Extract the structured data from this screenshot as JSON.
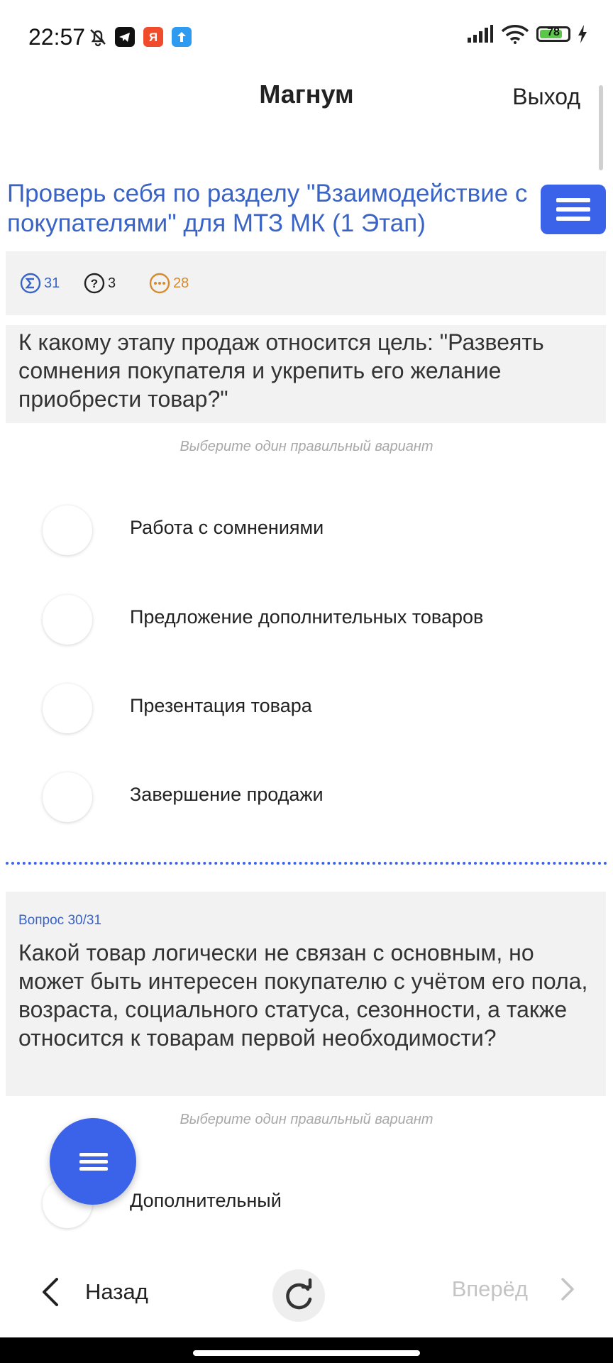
{
  "status_bar": {
    "time": "22:57",
    "battery": "78",
    "battery_level": 0.78,
    "icons": [
      "bell-off-icon",
      "telegram-icon",
      "yandex-icon",
      "upload-icon",
      "signal-icon",
      "wifi-icon",
      "charging-icon"
    ]
  },
  "header": {
    "title": "Магнум",
    "exit_label": "Выход"
  },
  "test": {
    "title": "Проверь себя по разделу \"Взаимодействие с покупателями\" для МТЗ МК (1 Этап)"
  },
  "stats": {
    "total": "31",
    "answered": "3",
    "remaining": "28",
    "colors": {
      "total": "#3a63c6",
      "answered": "#222222",
      "remaining": "#d68a2c"
    }
  },
  "questions": [
    {
      "text": "К какому этапу продаж относится цель: \"Развеять сомнения покупателя и укрепить его желание приобрести товар?\"",
      "hint": "Выберите один правильный вариант",
      "options": [
        "Работа с сомнениями",
        "Предложение дополнительных товаров",
        "Презентация товара",
        "Завершение продажи"
      ]
    },
    {
      "number": "Вопрос 30/31",
      "text": "Какой товар логически не связан с основным, но может быть интересен покупателю с учётом его пола, возраста, социального статуса, сезонности, а также относится к товарам первой необходимости?",
      "hint": "Выберите один правильный вариант",
      "options": [
        "Дополнительный"
      ]
    }
  ],
  "nav": {
    "back_label": "Назад",
    "forward_label": "Вперёд"
  },
  "colors": {
    "accent": "#3b63ea",
    "link_text": "#3a63c6",
    "panel_bg": "#f2f2f2"
  }
}
